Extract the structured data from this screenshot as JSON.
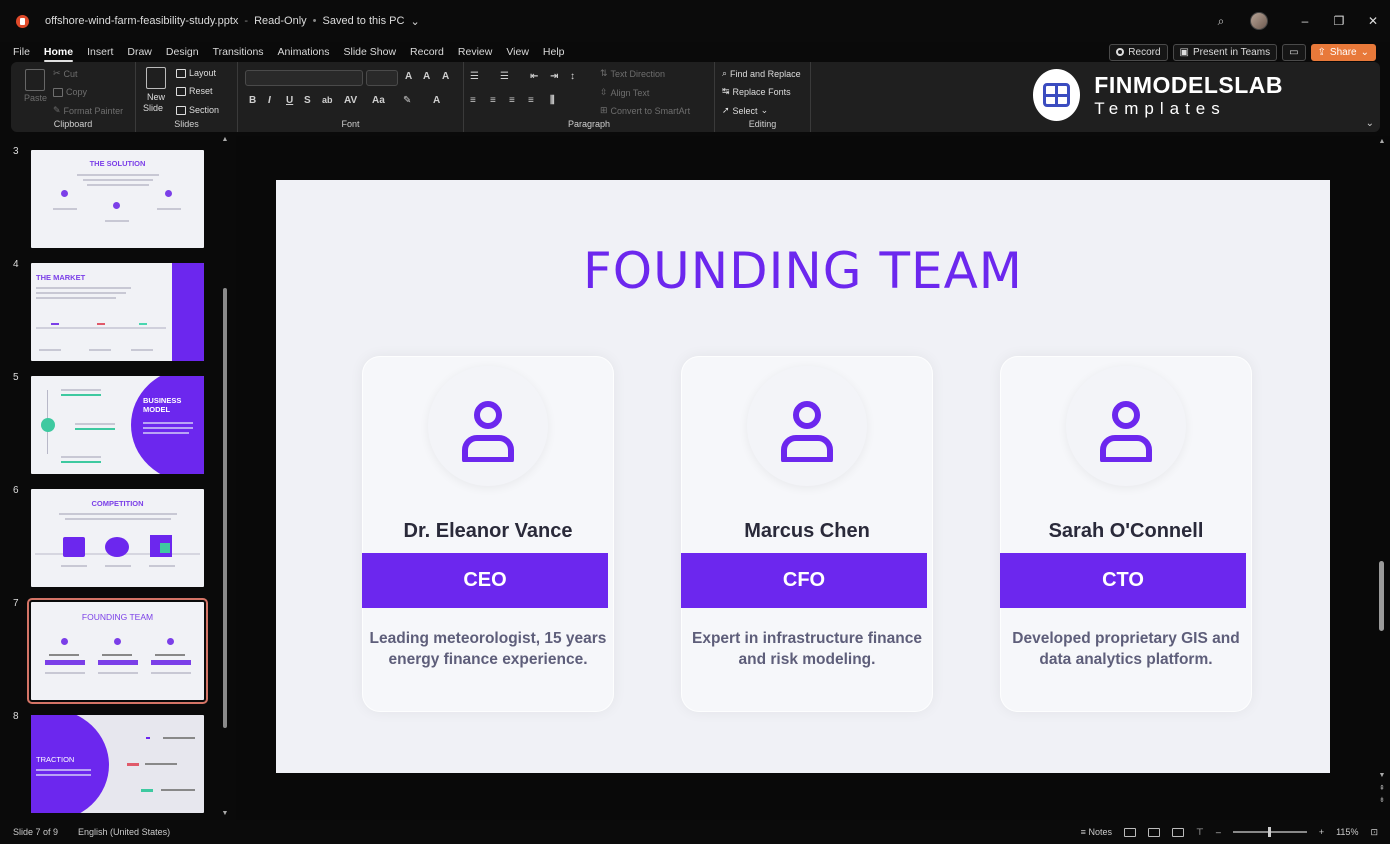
{
  "window": {
    "file_name": "offshore-wind-farm-feasibility-study.pptx",
    "status": "Read-Only",
    "save_state": "Saved to this PC"
  },
  "menu": {
    "tabs": [
      "File",
      "Home",
      "Insert",
      "Draw",
      "Design",
      "Transitions",
      "Animations",
      "Slide Show",
      "Record",
      "Review",
      "View",
      "Help"
    ],
    "active_tab": "Home",
    "record_label": "Record",
    "present_label": "Present in Teams",
    "share_label": "Share"
  },
  "ribbon": {
    "clipboard": {
      "paste": "Paste",
      "cut": "Cut",
      "copy": "Copy",
      "format_painter": "Format Painter",
      "label": "Clipboard"
    },
    "slides": {
      "new_slide_1": "New",
      "new_slide_2": "Slide",
      "layout": "Layout",
      "reset": "Reset",
      "section": "Section",
      "label": "Slides"
    },
    "font": {
      "label": "Font",
      "bold": "B",
      "italic": "I",
      "underline": "U",
      "strike": "S",
      "shadow": "ab"
    },
    "paragraph": {
      "label": "Paragraph",
      "text_direction": "Text Direction",
      "align_text": "Align Text",
      "convert_smartart": "Convert to SmartArt"
    },
    "editing": {
      "find_replace": "Find and Replace",
      "replace_fonts": "Replace Fonts",
      "select": "Select",
      "label": "Editing"
    },
    "brand": {
      "name": "FINMODELSLAB",
      "tagline": "Templates"
    }
  },
  "thumbnails": [
    {
      "number": "3",
      "title": "THE SOLUTION"
    },
    {
      "number": "4",
      "title": "THE MARKET"
    },
    {
      "number": "5",
      "title": "BUSINESS MODEL"
    },
    {
      "number": "6",
      "title": "COMPETITION"
    },
    {
      "number": "7",
      "title": "FOUNDING TEAM",
      "selected": true
    },
    {
      "number": "8",
      "title": "TRACTION"
    }
  ],
  "slide": {
    "title": "FOUNDING TEAM",
    "accent_color": "#6c27ee",
    "members": [
      {
        "name": "Dr. Eleanor Vance",
        "role": "CEO",
        "desc_1": "Leading meteorologist, 15 years",
        "desc_2": "energy finance experience."
      },
      {
        "name": "Marcus Chen",
        "role": "CFO",
        "desc_1": "Expert in infrastructure finance",
        "desc_2": "and risk modeling."
      },
      {
        "name": "Sarah O'Connell",
        "role": "CTO",
        "desc_1": "Developed proprietary GIS and",
        "desc_2": "data analytics platform."
      }
    ]
  },
  "status": {
    "slide_indicator": "Slide 7 of 9",
    "language": "English (United States)",
    "notes_label": "Notes",
    "zoom": "115%"
  }
}
